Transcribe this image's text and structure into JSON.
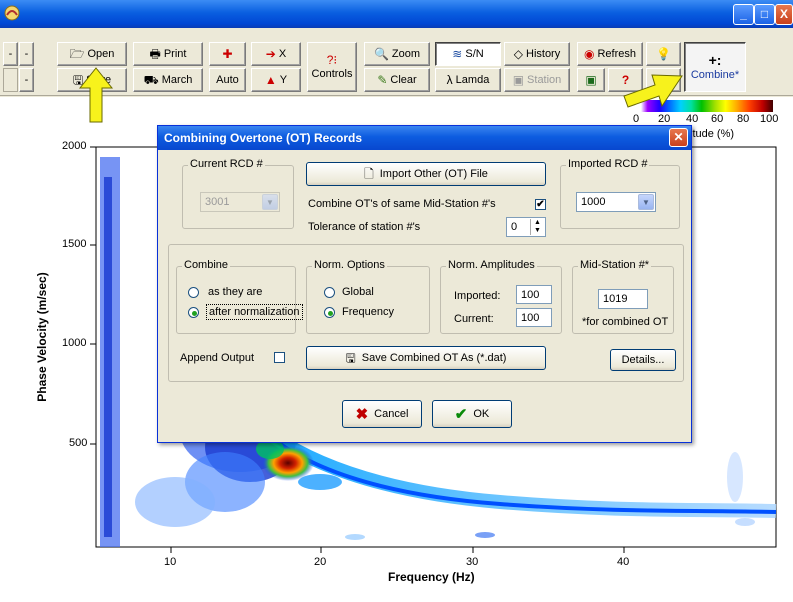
{
  "window": {
    "minimize": "_",
    "maximize": "□",
    "close": "X"
  },
  "toolbar": {
    "minus_top": "-",
    "minus_top2": "-",
    "minus_bottom": "-",
    "open": "Open",
    "save": "Save",
    "print": "Print",
    "march": "March",
    "auto": "Auto",
    "x_axis": "X",
    "y_axis": "Y",
    "controls": "Controls",
    "zoom": "Zoom",
    "clear": "Clear",
    "sn": "S/N",
    "lamda": "Lamda",
    "history": "History",
    "station": "Station",
    "refresh": "Refresh",
    "combine": "Combine*",
    "combine_icon": "+:"
  },
  "colorbar": {
    "ticks": [
      "0",
      "20",
      "40",
      "60",
      "80",
      "100"
    ],
    "label": "itude (%)"
  },
  "plot": {
    "ylabel": "Phase Velocity (m/sec)",
    "xlabel": "Frequency (Hz)",
    "yticks": [
      "2000",
      "1500",
      "1000",
      "500"
    ],
    "xticks": [
      "10",
      "20",
      "30",
      "40"
    ]
  },
  "dialog": {
    "title": "Combining Overtone (OT) Records",
    "current_rcd_label": "Current RCD #",
    "current_rcd_value": "3001",
    "import_button": "Import Other (OT) File",
    "combine_same_label": "Combine OT's of same Mid-Station #'s",
    "combine_same_checked": "✔",
    "tolerance_label": "Tolerance of station #'s",
    "tolerance_value": "0",
    "imported_rcd_label": "Imported RCD #",
    "imported_rcd_value": "1000",
    "combine_group": "Combine",
    "as_they_are": "as they are",
    "after_normalization": "after normalization",
    "norm_options_group": "Norm. Options",
    "global": "Global",
    "frequency": "Frequency",
    "norm_amplitudes_group": "Norm. Amplitudes",
    "imported_label": "Imported:",
    "imported_value": "100",
    "current_label": "Current:",
    "current_value": "100",
    "mid_station_group": "Mid-Station #*",
    "mid_station_value": "1019",
    "mid_station_note": "*for combined OT",
    "append_output": "Append Output",
    "save_button": "Save Combined OT As (*.dat)",
    "details_button": "Details...",
    "cancel_button": "Cancel",
    "ok_button": "OK"
  },
  "colors": {
    "titlebar": "#0a5fe0",
    "dialog_face": "#ece9d8",
    "arrow": "#f7f21c"
  }
}
